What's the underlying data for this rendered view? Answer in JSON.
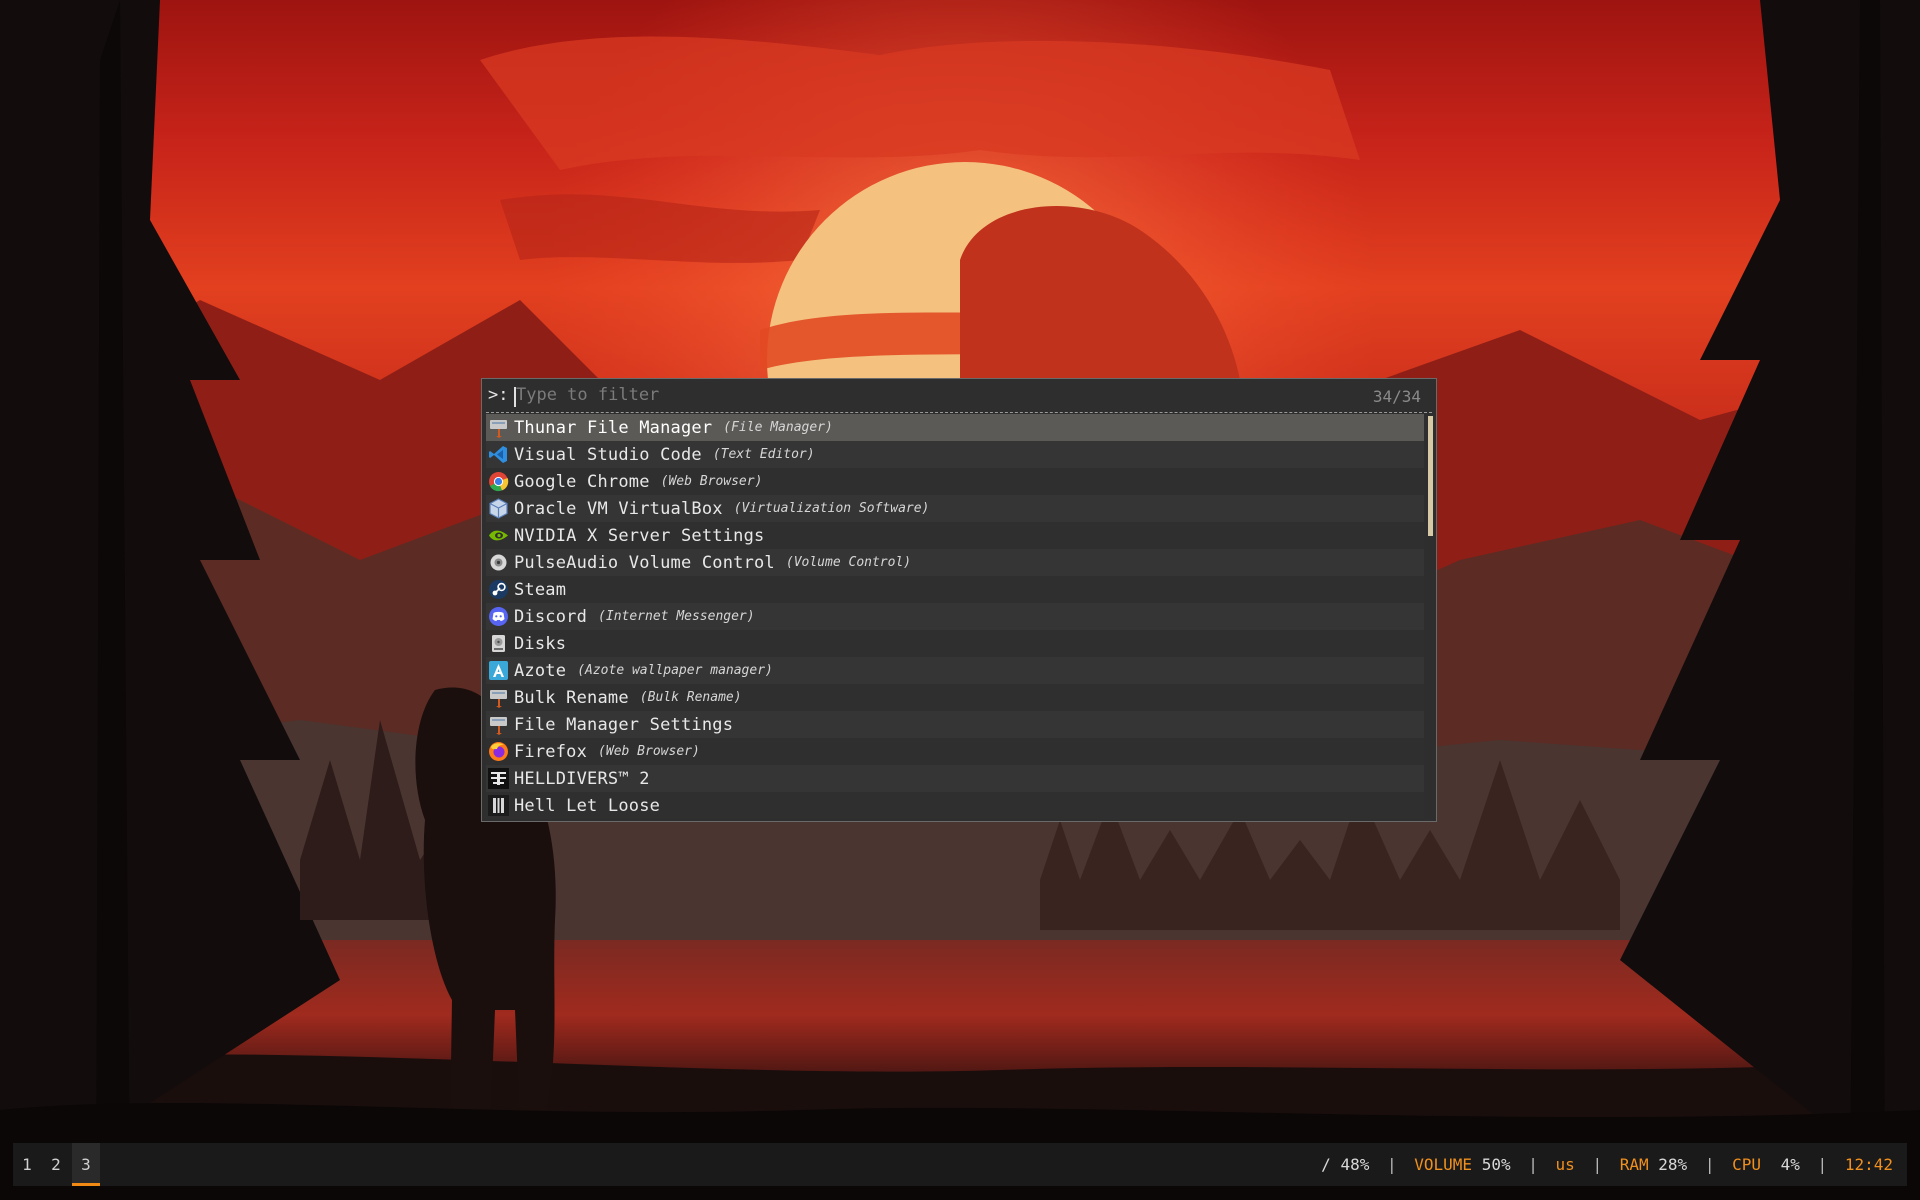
{
  "launcher": {
    "prompt": ">:",
    "placeholder": "Type to filter",
    "counter": "34/34",
    "items": [
      {
        "label": "Thunar File Manager",
        "desc": "(File Manager)",
        "icon": "thunar-icon"
      },
      {
        "label": "Visual Studio Code",
        "desc": "(Text Editor)",
        "icon": "vscode-icon"
      },
      {
        "label": "Google Chrome",
        "desc": "(Web Browser)",
        "icon": "chrome-icon"
      },
      {
        "label": "Oracle VM VirtualBox",
        "desc": "(Virtualization Software)",
        "icon": "virtualbox-icon"
      },
      {
        "label": "NVIDIA X Server Settings",
        "desc": "",
        "icon": "nvidia-icon"
      },
      {
        "label": "PulseAudio Volume Control",
        "desc": "(Volume Control)",
        "icon": "pulseaudio-icon"
      },
      {
        "label": "Steam",
        "desc": "",
        "icon": "steam-icon"
      },
      {
        "label": "Discord",
        "desc": "(Internet Messenger)",
        "icon": "discord-icon"
      },
      {
        "label": "Disks",
        "desc": "",
        "icon": "disks-icon"
      },
      {
        "label": "Azote",
        "desc": "(Azote wallpaper manager)",
        "icon": "azote-icon"
      },
      {
        "label": "Bulk Rename",
        "desc": "(Bulk Rename)",
        "icon": "bulk-rename-icon"
      },
      {
        "label": "File Manager Settings",
        "desc": "",
        "icon": "file-manager-settings-icon"
      },
      {
        "label": "Firefox",
        "desc": "(Web Browser)",
        "icon": "firefox-icon"
      },
      {
        "label": "HELLDIVERS™ 2",
        "desc": "",
        "icon": "helldivers-icon"
      },
      {
        "label": "Hell Let Loose",
        "desc": "",
        "icon": "hell-let-loose-icon"
      }
    ]
  },
  "taskbar": {
    "workspaces": [
      "1",
      "2",
      "3"
    ],
    "active_workspace": "3",
    "status": {
      "disk_label": "/",
      "disk_value": "48%",
      "volume_label": "VOLUME",
      "volume_value": "50%",
      "keyboard_layout": "us",
      "ram_label": "RAM",
      "ram_value": "28%",
      "cpu_label": "CPU",
      "cpu_value": "4%",
      "clock": "12:42"
    }
  },
  "colors": {
    "accent": "#f08a14",
    "selected_row": "#5c5a57",
    "launcher_bg": "#2e2e2e",
    "taskbar_bg": "#1a1a1a"
  }
}
